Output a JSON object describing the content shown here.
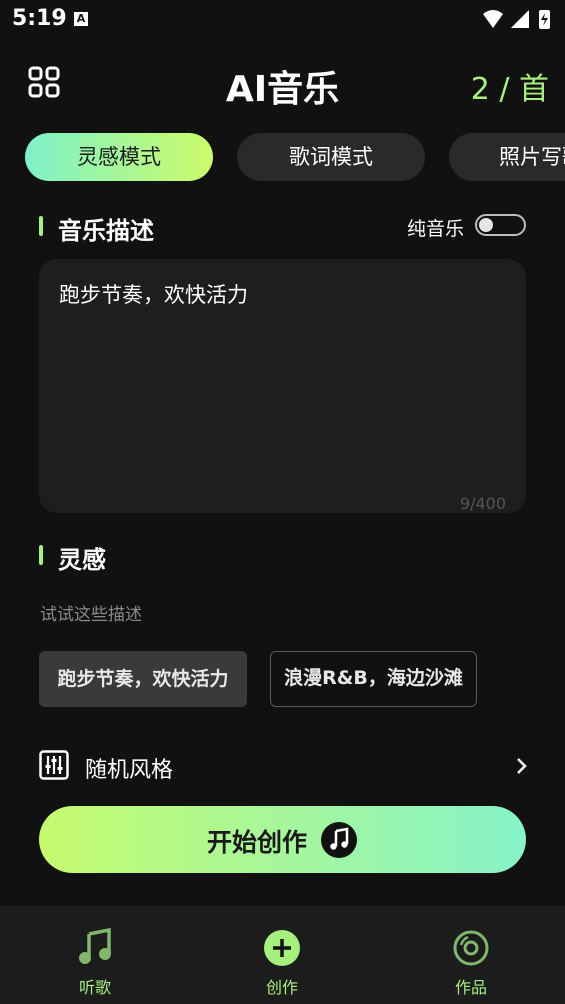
{
  "status": {
    "time": "5:19",
    "notif_glyph": "A"
  },
  "header": {
    "title": "AI音乐",
    "quota": "2 / 首",
    "menu_icon": "grid-icon"
  },
  "tabs": [
    {
      "label": "灵感模式",
      "active": true
    },
    {
      "label": "歌词模式",
      "active": false
    },
    {
      "label": "照片写歌",
      "active": false
    }
  ],
  "description": {
    "section_title": "音乐描述",
    "pure_music_label": "纯音乐",
    "pure_music_on": false,
    "value": "跑步节奏，欢快活力",
    "count": "9/400"
  },
  "inspiration": {
    "section_title": "灵感",
    "hint": "试试这些描述",
    "chips": [
      "跑步节奏，欢快活力",
      "浪漫R&B，海边沙滩"
    ]
  },
  "random_style": {
    "label": "随机风格"
  },
  "start": {
    "label": "开始创作"
  },
  "nav": [
    {
      "label": "听歌",
      "icon": "music-note-icon"
    },
    {
      "label": "创作",
      "icon": "plus-circle-icon"
    },
    {
      "label": "作品",
      "icon": "disc-icon"
    }
  ],
  "colors": {
    "accent": "#a6f07c",
    "gradient_start": "#c6fb6d",
    "gradient_end": "#86f3c9",
    "background": "#111111"
  }
}
